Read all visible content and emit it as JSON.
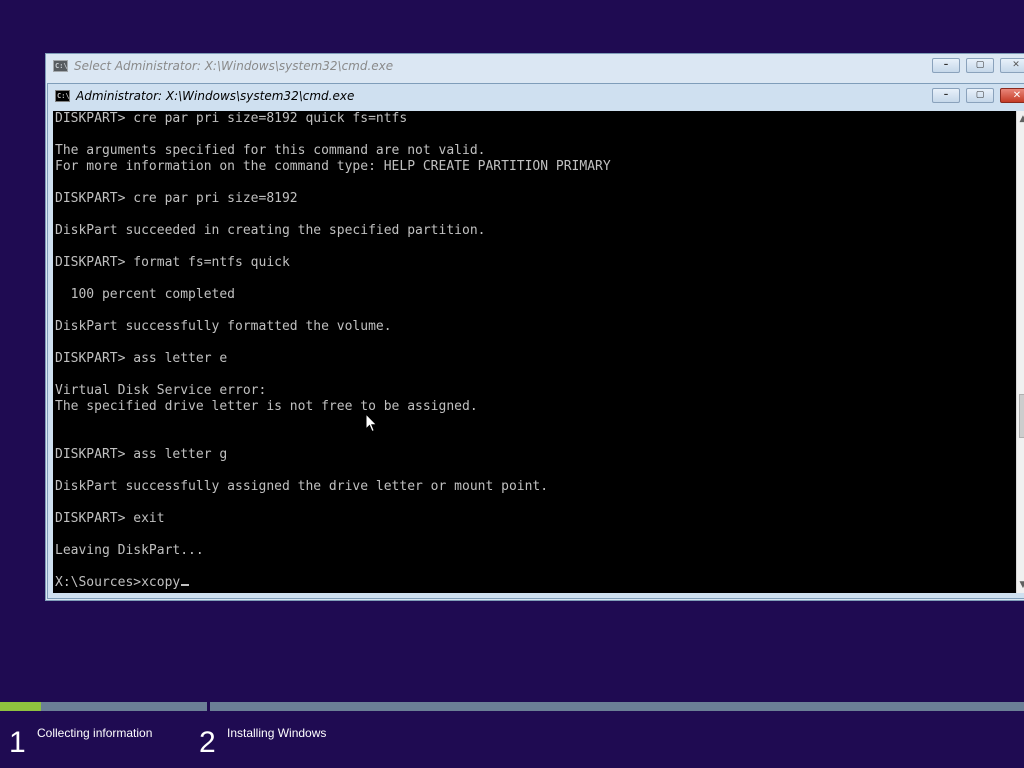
{
  "back_window": {
    "title": "Select Administrator: X:\\Windows\\system32\\cmd.exe",
    "icon": "cmd-icon"
  },
  "front_window": {
    "title": "Administrator: X:\\Windows\\system32\\cmd.exe",
    "icon": "cmd-icon",
    "controls": {
      "minimize": "–",
      "maximize": "▢",
      "close": "✕"
    }
  },
  "console": {
    "lines": [
      "DISKPART> cre par pri size=8192 quick fs=ntfs",
      "",
      "The arguments specified for this command are not valid.",
      "For more information on the command type: HELP CREATE PARTITION PRIMARY",
      "",
      "DISKPART> cre par pri size=8192",
      "",
      "DiskPart succeeded in creating the specified partition.",
      "",
      "DISKPART> format fs=ntfs quick",
      "",
      "  100 percent completed",
      "",
      "DiskPart successfully formatted the volume.",
      "",
      "DISKPART> ass letter e",
      "",
      "Virtual Disk Service error:",
      "The specified drive letter is not free to be assigned.",
      "",
      "",
      "DISKPART> ass letter g",
      "",
      "DiskPart successfully assigned the drive letter or mount point.",
      "",
      "DISKPART> exit",
      "",
      "Leaving DiskPart...",
      "",
      "X:\\Sources>xcopy"
    ]
  },
  "setup": {
    "steps": [
      {
        "number": "1",
        "label": "Collecting information"
      },
      {
        "number": "2",
        "label": "Installing Windows"
      }
    ],
    "step1_progress": 0.2
  },
  "colors": {
    "desktop": "#1f0b52",
    "progress_fill": "#8fc23f",
    "progress_track": "#6b7f96",
    "console_bg": "#000000",
    "console_text": "#c0c0c0"
  }
}
